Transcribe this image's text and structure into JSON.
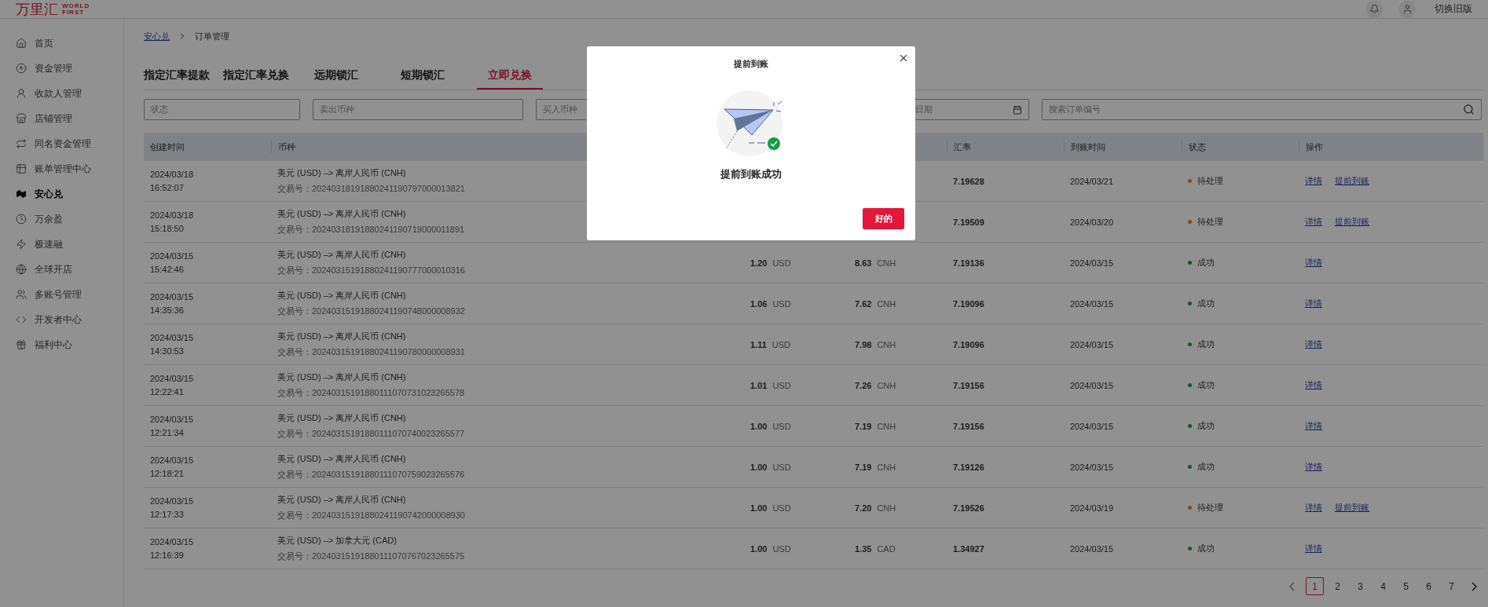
{
  "header": {
    "logo_text": "万里汇",
    "logo_sub": [
      "WORLD",
      "FIRST"
    ],
    "switch_label": "切换旧版"
  },
  "sidebar": {
    "items": [
      {
        "label": "首页",
        "selected": false
      },
      {
        "label": "资金管理",
        "selected": false
      },
      {
        "label": "收款人管理",
        "selected": false
      },
      {
        "label": "店铺管理",
        "selected": false
      },
      {
        "label": "同名资金管理",
        "selected": false
      },
      {
        "label": "账单管理中心",
        "selected": false
      },
      {
        "label": "安心兑",
        "selected": true
      },
      {
        "label": "万余盈",
        "selected": false
      },
      {
        "label": "极速融",
        "selected": false
      },
      {
        "label": "全球开店",
        "selected": false
      },
      {
        "label": "多账号管理",
        "selected": false
      },
      {
        "label": "开发者中心",
        "selected": false
      },
      {
        "label": "福利中心",
        "selected": false
      }
    ]
  },
  "breadcrumb": {
    "link": "安心兑",
    "current": "订单管理"
  },
  "tabs": [
    {
      "label": "指定汇率提款",
      "selected": false
    },
    {
      "label": "指定汇率兑换",
      "selected": false
    },
    {
      "label": "远期锁汇",
      "selected": false
    },
    {
      "label": "短期锁汇",
      "selected": false
    },
    {
      "label": "立即兑换",
      "selected": true
    }
  ],
  "filters": [
    {
      "placeholder": "状态",
      "kind": "select"
    },
    {
      "placeholder": "卖出币种",
      "kind": "select"
    },
    {
      "placeholder": "买入币种",
      "kind": "select"
    },
    {
      "placeholder": "日期",
      "kind": "date"
    },
    {
      "placeholder": "搜索订单编号",
      "kind": "search"
    }
  ],
  "table": {
    "columns": [
      "创建时间",
      "币种",
      "",
      "",
      "汇率",
      "到账时间",
      "状态",
      "操作"
    ],
    "rows": [
      {
        "date": "2024/03/18",
        "time": "16:52:07",
        "pair": "美元 (USD) –> 离岸人民币 (CNH)",
        "trade_no": "交易号：20240318191880241190797000013821",
        "rate": "7.19628",
        "arrival": "2024/03/21",
        "status": {
          "label": "待处理",
          "color": "#804c18"
        },
        "actions": [
          "详情",
          "提前到账"
        ]
      },
      {
        "date": "2024/03/18",
        "time": "15:18:50",
        "pair": "美元 (USD) –> 离岸人民币 (CNH)",
        "trade_no": "交易号：20240318191880241190719000011891",
        "rate": "7.19509",
        "arrival": "2024/03/20",
        "status": {
          "label": "待处理",
          "color": "#804c18"
        },
        "actions": [
          "详情",
          "提前到账"
        ]
      },
      {
        "date": "2024/03/15",
        "time": "15:42:46",
        "pair": "美元 (USD) –> 离岸人民币 (CNH)",
        "trade_no": "交易号：20240315191880241190777000010316",
        "sell": {
          "amount": "1.20",
          "ccy": "USD"
        },
        "buy": {
          "amount": "8.63",
          "ccy": "CNH"
        },
        "rate": "7.19136",
        "arrival": "2024/03/15",
        "status": {
          "label": "成功",
          "color": "#115823"
        },
        "actions": [
          "详情"
        ]
      },
      {
        "date": "2024/03/15",
        "time": "14:35:36",
        "pair": "美元 (USD) –> 离岸人民币 (CNH)",
        "trade_no": "交易号：20240315191880241190748000008932",
        "sell": {
          "amount": "1.06",
          "ccy": "USD"
        },
        "buy": {
          "amount": "7.62",
          "ccy": "CNH"
        },
        "rate": "7.19096",
        "arrival": "2024/03/15",
        "status": {
          "label": "成功",
          "color": "#115823"
        },
        "actions": [
          "详情"
        ]
      },
      {
        "date": "2024/03/15",
        "time": "14:30:53",
        "pair": "美元 (USD) –> 离岸人民币 (CNH)",
        "trade_no": "交易号：20240315191880241190780000008931",
        "sell": {
          "amount": "1.11",
          "ccy": "USD"
        },
        "buy": {
          "amount": "7.98",
          "ccy": "CNH"
        },
        "rate": "7.19096",
        "arrival": "2024/03/15",
        "status": {
          "label": "成功",
          "color": "#115823"
        },
        "actions": [
          "详情"
        ]
      },
      {
        "date": "2024/03/15",
        "time": "12:22:41",
        "pair": "美元 (USD) –> 离岸人民币 (CNH)",
        "trade_no": "交易号：20240315191880111070731023265578",
        "sell": {
          "amount": "1.01",
          "ccy": "USD"
        },
        "buy": {
          "amount": "7.26",
          "ccy": "CNH"
        },
        "rate": "7.19156",
        "arrival": "2024/03/15",
        "status": {
          "label": "成功",
          "color": "#115823"
        },
        "actions": [
          "详情"
        ]
      },
      {
        "date": "2024/03/15",
        "time": "12:21:34",
        "pair": "美元 (USD) –> 离岸人民币 (CNH)",
        "trade_no": "交易号：20240315191880111070740023265577",
        "sell": {
          "amount": "1.00",
          "ccy": "USD"
        },
        "buy": {
          "amount": "7.19",
          "ccy": "CNH"
        },
        "rate": "7.19156",
        "arrival": "2024/03/15",
        "status": {
          "label": "成功",
          "color": "#115823"
        },
        "actions": [
          "详情"
        ]
      },
      {
        "date": "2024/03/15",
        "time": "12:18:21",
        "pair": "美元 (USD) –> 离岸人民币 (CNH)",
        "trade_no": "交易号：20240315191880111070759023265576",
        "sell": {
          "amount": "1.00",
          "ccy": "USD"
        },
        "buy": {
          "amount": "7.19",
          "ccy": "CNH"
        },
        "rate": "7.19126",
        "arrival": "2024/03/15",
        "status": {
          "label": "成功",
          "color": "#115823"
        },
        "actions": [
          "详情"
        ]
      },
      {
        "date": "2024/03/15",
        "time": "12:17:33",
        "pair": "美元 (USD) –> 离岸人民币 (CNH)",
        "trade_no": "交易号：20240315191880241190742000008930",
        "sell": {
          "amount": "1.00",
          "ccy": "USD"
        },
        "buy": {
          "amount": "7.20",
          "ccy": "CNH"
        },
        "rate": "7.19526",
        "arrival": "2024/03/19",
        "status": {
          "label": "待处理",
          "color": "#804c18"
        },
        "actions": [
          "详情",
          "提前到账"
        ]
      },
      {
        "date": "2024/03/15",
        "time": "12:16:39",
        "pair": "美元 (USD) –> 加拿大元 (CAD)",
        "trade_no": "交易号：20240315191880111070767023265575",
        "sell": {
          "amount": "1.00",
          "ccy": "USD"
        },
        "buy": {
          "amount": "1.35",
          "ccy": "CAD"
        },
        "rate": "1.34927",
        "arrival": "2024/03/15",
        "status": {
          "label": "成功",
          "color": "#115823"
        },
        "actions": [
          "详情"
        ]
      }
    ]
  },
  "pagination": {
    "pages": [
      {
        "label": "1",
        "selected": true
      },
      {
        "label": "2",
        "selected": false
      },
      {
        "label": "3",
        "selected": false
      },
      {
        "label": "4",
        "selected": false
      },
      {
        "label": "5",
        "selected": false
      },
      {
        "label": "6",
        "selected": false
      },
      {
        "label": "7",
        "selected": false
      }
    ]
  },
  "modal": {
    "title": "提前到账",
    "message": "提前到账成功",
    "button": "好的"
  }
}
